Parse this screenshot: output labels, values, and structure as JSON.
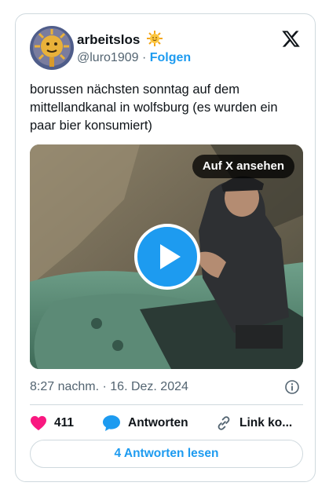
{
  "author": {
    "name": "arbeitslos",
    "handle": "@luro1909",
    "separator": "·",
    "follow_label": "Folgen"
  },
  "tweet": {
    "text": "borussen nächsten sonntag auf dem mittellandkanal in wolfsburg (es wurden ein paar bier konsumiert)",
    "timestamp": "8:27 nachm. · 16. Dez. 2024"
  },
  "media": {
    "view_on_x_label": "Auf X ansehen",
    "play_icon": "play-icon"
  },
  "actions": {
    "like_count": "411",
    "reply_label": "Antworten",
    "copy_link_label": "Link ko..."
  },
  "replies_button_label": "4 Antworten lesen",
  "colors": {
    "accent": "#1d9bf0",
    "like": "#f91880",
    "text": "#0f1419",
    "muted": "#536471",
    "border": "#cfd9de"
  }
}
